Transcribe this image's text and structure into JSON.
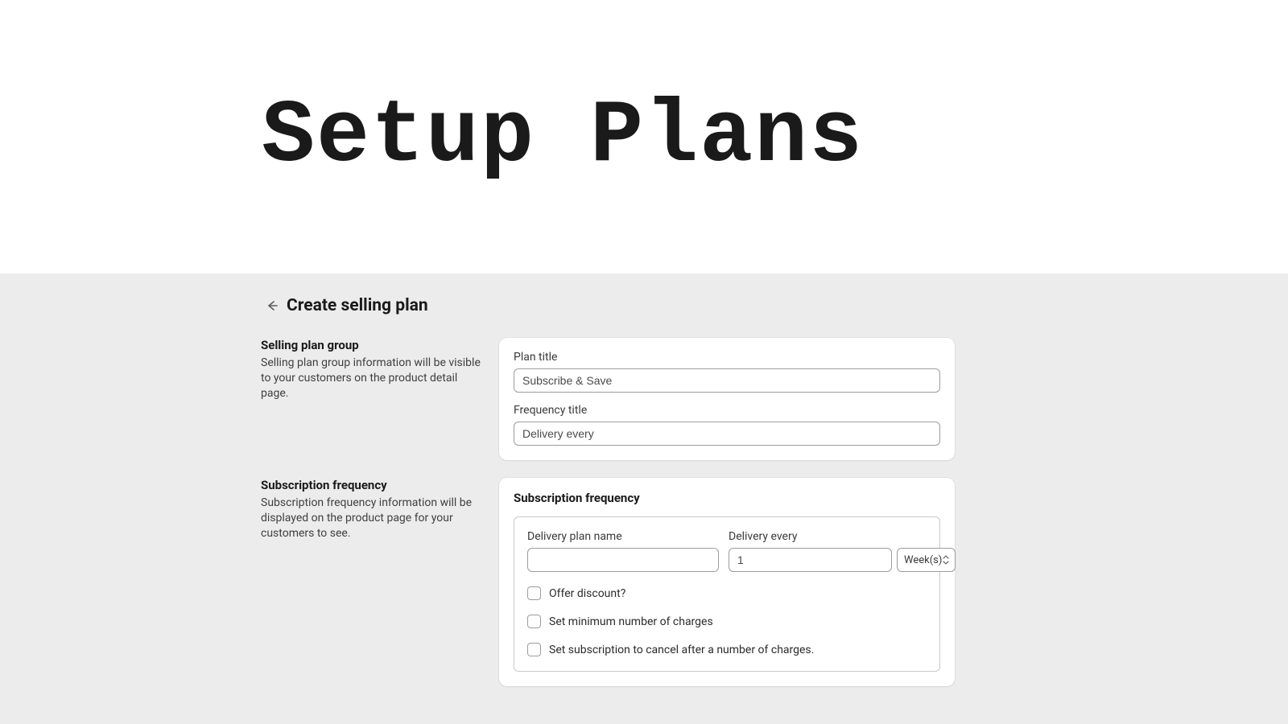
{
  "hero": {
    "title": "Setup Plans"
  },
  "page": {
    "title": "Create selling plan"
  },
  "sections": {
    "group": {
      "title": "Selling plan group",
      "desc": "Selling plan group information will be visible to your customers on the product detail page.",
      "planTitleLabel": "Plan title",
      "planTitleValue": "Subscribe & Save",
      "freqTitleLabel": "Frequency title",
      "freqTitleValue": "Delivery every"
    },
    "freq": {
      "title": "Subscription frequency",
      "desc": "Subscription frequency information will be displayed on the product page for your customers to see.",
      "cardTitle": "Subscription frequency",
      "deliveryNameLabel": "Delivery plan name",
      "deliveryNameValue": "",
      "deliveryEveryLabel": "Delivery every",
      "deliveryEveryValue": "1",
      "unitLabel": "Week(s)",
      "checks": {
        "offerDiscount": "Offer discount?",
        "minCharges": "Set minimum number of charges",
        "cancelAfter": "Set subscription to cancel after a number of charges."
      }
    }
  }
}
